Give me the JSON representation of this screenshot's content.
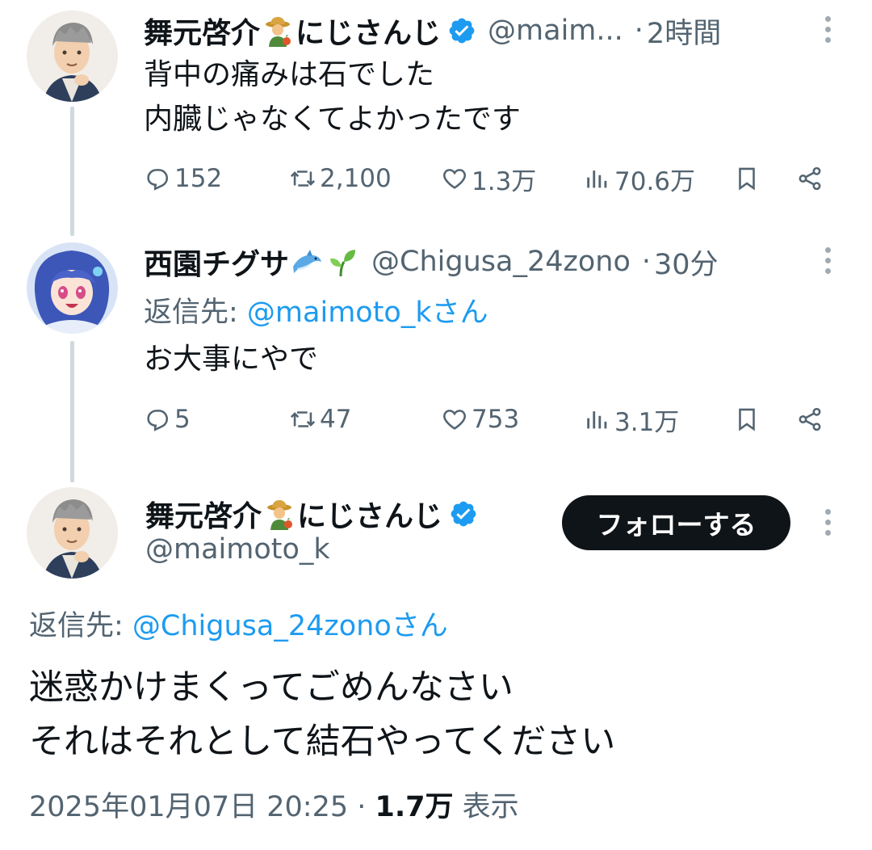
{
  "thread": [
    {
      "display_name": "舞元啓介",
      "display_name_suffix": "にじさんじ",
      "name_emoji": "farmer-emoji",
      "verified": true,
      "handle": "@maim...",
      "separator": "·",
      "time": "2時間",
      "text_lines": [
        "背中の痛みは石でした",
        "内臓じゃなくてよかったです"
      ],
      "replies": "152",
      "retweets": "2,100",
      "likes": "1.3万",
      "views": "70.6万"
    },
    {
      "display_name": "西園チグサ",
      "name_emoji": [
        "dolphin-emoji",
        "seedling-emoji"
      ],
      "verified": false,
      "handle": "@Chigusa_24zono",
      "separator": "·",
      "time": "30分",
      "reply_to_label": "返信先: ",
      "reply_to_mention": "@maimoto_kさん",
      "text_lines": [
        "お大事にやで"
      ],
      "replies": "5",
      "retweets": "47",
      "likes": "753",
      "views": "3.1万"
    }
  ],
  "main_tweet": {
    "display_name": "舞元啓介",
    "display_name_suffix": "にじさんじ",
    "handle": "@maimoto_k",
    "follow_label": "フォローする",
    "reply_to_label": "返信先: ",
    "reply_to_mention": "@Chigusa_24zonoさん",
    "text_lines": [
      "迷惑かけまくってごめんなさい",
      "それはそれとして結石やってください"
    ],
    "timestamp": "2025年01月07日 20:25 · ",
    "views_count": "1.7万",
    "views_label": " 表示"
  },
  "colors": {
    "text": "#0f1419",
    "secondary": "#536471",
    "link": "#1d9bf0",
    "verified": "#1d9bf0",
    "thread_line": "#cfd9de"
  }
}
